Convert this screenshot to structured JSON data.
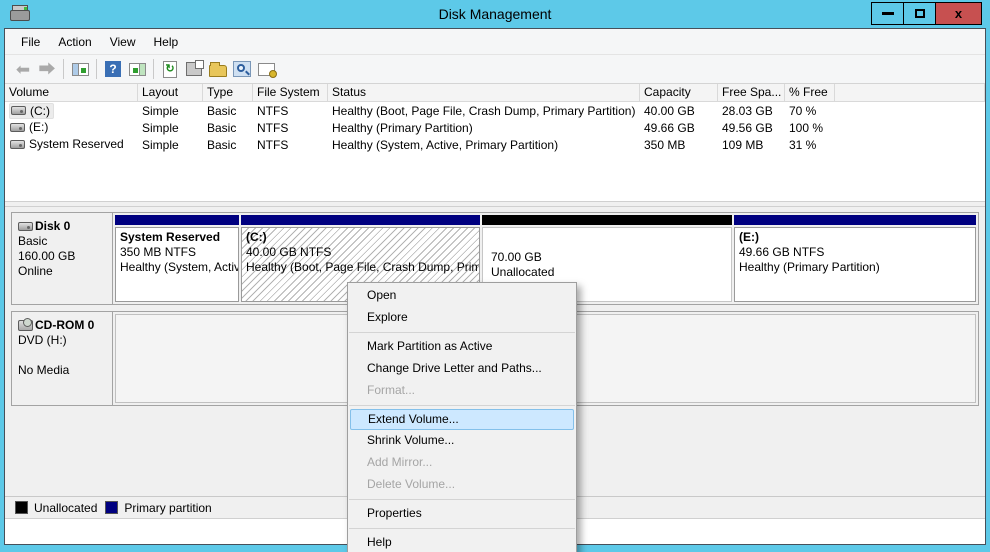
{
  "window": {
    "title": "Disk Management",
    "controls": {
      "minimize": "minimize",
      "maximize": "maximize",
      "close": "close"
    }
  },
  "menu_bar": {
    "items": [
      "File",
      "Action",
      "View",
      "Help"
    ]
  },
  "toolbar": {
    "icons": [
      "back-icon",
      "forward-icon",
      "show-console-tree-icon",
      "help-icon",
      "show-action-pane-icon",
      "refresh-icon",
      "properties-icon",
      "open-folder-icon",
      "search-icon",
      "snapin-settings-icon"
    ]
  },
  "volume_table": {
    "columns": [
      "Volume",
      "Layout",
      "Type",
      "File System",
      "Status",
      "Capacity",
      "Free Spa...",
      "% Free"
    ],
    "rows": [
      {
        "volume": "(C:)",
        "layout": "Simple",
        "type": "Basic",
        "fs": "NTFS",
        "status": "Healthy (Boot, Page File, Crash Dump, Primary Partition)",
        "capacity": "40.00 GB",
        "free": "28.03 GB",
        "pct_free": "70 %"
      },
      {
        "volume": "(E:)",
        "layout": "Simple",
        "type": "Basic",
        "fs": "NTFS",
        "status": "Healthy (Primary Partition)",
        "capacity": "49.66 GB",
        "free": "49.56 GB",
        "pct_free": "100 %"
      },
      {
        "volume": "System Reserved",
        "layout": "Simple",
        "type": "Basic",
        "fs": "NTFS",
        "status": "Healthy (System, Active, Primary Partition)",
        "capacity": "350 MB",
        "free": "109 MB",
        "pct_free": "31 %"
      }
    ]
  },
  "disks": [
    {
      "name": "Disk 0",
      "kind": "Basic",
      "size": "160.00 GB",
      "state": "Online",
      "partitions": [
        {
          "title": "System Reserved",
          "line2": "350 MB NTFS",
          "line3": "Healthy (System, Active, Primary Partition)"
        },
        {
          "title": "(C:)",
          "line2": "40.00 GB NTFS",
          "line3": "Healthy (Boot, Page File, Crash Dump, Primary Partition)"
        },
        {
          "line2": "70.00 GB",
          "line3": "Unallocated"
        },
        {
          "title": "(E:)",
          "line2": "49.66 GB NTFS",
          "line3": "Healthy (Primary Partition)"
        }
      ]
    },
    {
      "name": "CD-ROM 0",
      "kind": "DVD (H:)",
      "state": "No Media"
    }
  ],
  "context_menu": {
    "items": [
      {
        "label": "Open"
      },
      {
        "label": "Explore"
      },
      {
        "label": "Mark Partition as Active"
      },
      {
        "label": "Change Drive Letter and Paths..."
      },
      {
        "label": "Format...",
        "disabled": true
      },
      {
        "label": "Extend Volume...",
        "highlighted": true
      },
      {
        "label": "Shrink Volume..."
      },
      {
        "label": "Add Mirror...",
        "disabled": true
      },
      {
        "label": "Delete Volume...",
        "disabled": true
      },
      {
        "label": "Properties"
      },
      {
        "label": "Help"
      }
    ]
  },
  "legend": {
    "items": [
      {
        "label": "Unallocated",
        "color": "#000000"
      },
      {
        "label": "Primary partition",
        "color": "#000080"
      }
    ]
  },
  "colors": {
    "titlebar": "#5dc9e8",
    "close_button": "#c75050",
    "primary_partition_band": "#000080",
    "unallocated_band": "#000000",
    "menu_highlight_bg": "#cde8ff",
    "menu_highlight_border": "#84c0ea"
  }
}
